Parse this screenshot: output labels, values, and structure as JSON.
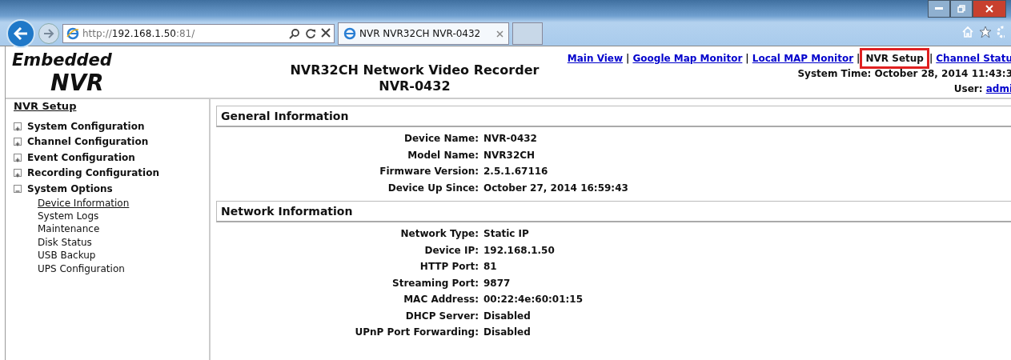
{
  "browser": {
    "address": {
      "prefix": "http://",
      "host": "192.168.1.50",
      "suffix": ":81/"
    },
    "tab": {
      "title": "NVR NVR32CH NVR-0432"
    }
  },
  "header": {
    "logo": [
      "Embedded",
      "NVR"
    ],
    "title": "NVR32CH Network Video Recorder",
    "subtitle": "NVR-0432",
    "nav": [
      {
        "label": "Main View",
        "kind": "link",
        "highlighted": false
      },
      {
        "label": "|",
        "kind": "separator",
        "highlighted": false
      },
      {
        "label": "Google Map Monitor",
        "kind": "link",
        "highlighted": false
      },
      {
        "label": "|",
        "kind": "separator",
        "highlighted": false
      },
      {
        "label": "Local MAP Monitor",
        "kind": "link",
        "highlighted": false
      },
      {
        "label": "|",
        "kind": "separator",
        "highlighted": false
      },
      {
        "label": "NVR Setup",
        "kind": "current",
        "highlighted": true
      },
      {
        "label": "|",
        "kind": "separator",
        "highlighted": false
      },
      {
        "label": "Channel Statu",
        "kind": "link",
        "highlighted": false
      }
    ],
    "system_time": {
      "label": "System Time:",
      "value": "October 28, 2014 11:43:3"
    },
    "user": {
      "label": "User:",
      "value": "admi"
    }
  },
  "sidebar": {
    "title": "NVR Setup",
    "items": [
      {
        "label": "System Configuration",
        "expanded": false
      },
      {
        "label": "Channel Configuration",
        "expanded": false
      },
      {
        "label": "Event Configuration",
        "expanded": false
      },
      {
        "label": "Recording Configuration",
        "expanded": false
      },
      {
        "label": "System Options",
        "expanded": true,
        "children": [
          {
            "label": "Device Information",
            "selected": true
          },
          {
            "label": "System Logs",
            "selected": false
          },
          {
            "label": "Maintenance",
            "selected": false
          },
          {
            "label": "Disk Status",
            "selected": false
          },
          {
            "label": "USB Backup",
            "selected": false
          },
          {
            "label": "UPS Configuration",
            "selected": false
          }
        ]
      }
    ]
  },
  "sections": [
    {
      "title": "General Information",
      "rows": [
        {
          "label": "Device Name:",
          "value": "NVR-0432"
        },
        {
          "label": "Model Name:",
          "value": "NVR32CH"
        },
        {
          "label": "Firmware Version:",
          "value": "2.5.1.67116"
        },
        {
          "label": "Device Up Since:",
          "value": "October 27, 2014 16:59:43"
        }
      ]
    },
    {
      "title": "Network Information",
      "rows": [
        {
          "label": "Network Type:",
          "value": "Static IP"
        },
        {
          "label": "Device IP:",
          "value": "192.168.1.50"
        },
        {
          "label": "HTTP Port:",
          "value": "81"
        },
        {
          "label": "Streaming Port:",
          "value": "9877"
        },
        {
          "label": "MAC Address:",
          "value": "00:22:4e:60:01:15"
        },
        {
          "label": "DHCP Server:",
          "value": "Disabled"
        },
        {
          "label": "UPnP Port Forwarding:",
          "value": "Disabled"
        }
      ]
    }
  ]
}
